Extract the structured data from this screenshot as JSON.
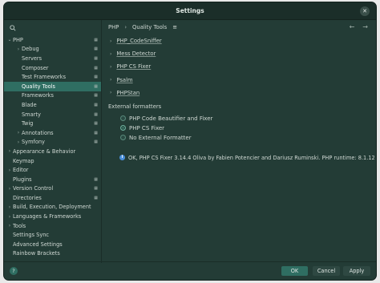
{
  "window": {
    "title": "Settings"
  },
  "sidebar": {
    "items": [
      {
        "label": "PHP",
        "arrow": "⌄",
        "indent": 0,
        "pin": true,
        "selected": false
      },
      {
        "label": "Debug",
        "arrow": "›",
        "indent": 1,
        "pin": true,
        "selected": false
      },
      {
        "label": "Servers",
        "arrow": "",
        "indent": 1,
        "pin": true,
        "selected": false
      },
      {
        "label": "Composer",
        "arrow": "",
        "indent": 1,
        "pin": true,
        "selected": false
      },
      {
        "label": "Test Frameworks",
        "arrow": "",
        "indent": 1,
        "pin": true,
        "selected": false
      },
      {
        "label": "Quality Tools",
        "arrow": "",
        "indent": 1,
        "pin": true,
        "selected": true
      },
      {
        "label": "Frameworks",
        "arrow": "",
        "indent": 1,
        "pin": true,
        "selected": false
      },
      {
        "label": "Blade",
        "arrow": "",
        "indent": 1,
        "pin": true,
        "selected": false
      },
      {
        "label": "Smarty",
        "arrow": "",
        "indent": 1,
        "pin": true,
        "selected": false
      },
      {
        "label": "Twig",
        "arrow": "",
        "indent": 1,
        "pin": true,
        "selected": false
      },
      {
        "label": "Annotations",
        "arrow": "›",
        "indent": 1,
        "pin": true,
        "selected": false
      },
      {
        "label": "Symfony",
        "arrow": "›",
        "indent": 1,
        "pin": true,
        "selected": false
      },
      {
        "label": "Appearance & Behavior",
        "arrow": "›",
        "indent": 0,
        "pin": false,
        "selected": false
      },
      {
        "label": "Keymap",
        "arrow": "",
        "indent": 0,
        "pin": false,
        "selected": false
      },
      {
        "label": "Editor",
        "arrow": "›",
        "indent": 0,
        "pin": false,
        "selected": false
      },
      {
        "label": "Plugins",
        "arrow": "",
        "indent": 0,
        "pin": true,
        "selected": false
      },
      {
        "label": "Version Control",
        "arrow": "›",
        "indent": 0,
        "pin": true,
        "selected": false
      },
      {
        "label": "Directories",
        "arrow": "",
        "indent": 0,
        "pin": true,
        "selected": false
      },
      {
        "label": "Build, Execution, Deployment",
        "arrow": "›",
        "indent": 0,
        "pin": false,
        "selected": false
      },
      {
        "label": "Languages & Frameworks",
        "arrow": "›",
        "indent": 0,
        "pin": false,
        "selected": false
      },
      {
        "label": "Tools",
        "arrow": "›",
        "indent": 0,
        "pin": false,
        "selected": false
      },
      {
        "label": "Settings Sync",
        "arrow": "",
        "indent": 0,
        "pin": false,
        "selected": false
      },
      {
        "label": "Advanced Settings",
        "arrow": "",
        "indent": 0,
        "pin": false,
        "selected": false
      },
      {
        "label": "Rainbow Brackets",
        "arrow": "",
        "indent": 0,
        "pin": false,
        "selected": false
      }
    ]
  },
  "breadcrumb": {
    "parent": "PHP",
    "separator": "›",
    "current": "Quality Tools",
    "menu": "≡"
  },
  "nav": {
    "back": "←",
    "forward": "→"
  },
  "sections": [
    {
      "label": "PHP_CodeSniffer"
    },
    {
      "label": "Mess Detector"
    },
    {
      "label": "PHP CS Fixer"
    },
    {
      "label": "Psalm"
    },
    {
      "label": "PHPStan"
    }
  ],
  "external_formatters": {
    "title": "External formatters",
    "options": [
      {
        "label": "PHP Code Beautifier and Fixer",
        "selected": false
      },
      {
        "label": "PHP CS Fixer",
        "selected": true
      },
      {
        "label": "No External Formatter",
        "selected": false
      }
    ]
  },
  "info_text": "OK, PHP CS Fixer 3.14.4 Oliva by Fabien Potencier and Dariusz Ruminski. PHP runtime: 8.1.12",
  "footer": {
    "help": "?",
    "ok": "OK",
    "cancel": "Cancel",
    "apply": "Apply"
  }
}
